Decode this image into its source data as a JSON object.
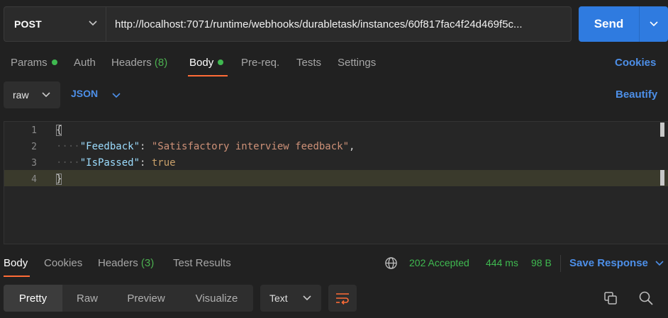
{
  "request": {
    "method": "POST",
    "url": "http://localhost:7071/runtime/webhooks/durabletask/instances/60f817fac4f24d469f5c...",
    "send_label": "Send"
  },
  "request_tabs": [
    {
      "label": "Params",
      "dot": true
    },
    {
      "label": "Auth"
    },
    {
      "label": "Headers",
      "count": "(8)"
    },
    {
      "label": "Body",
      "dot": true,
      "active": true
    },
    {
      "label": "Pre-req."
    },
    {
      "label": "Tests"
    },
    {
      "label": "Settings"
    }
  ],
  "cookies_label": "Cookies",
  "body_options": {
    "mode": "raw",
    "language": "JSON",
    "beautify_label": "Beautify"
  },
  "editor": {
    "line_numbers": [
      "1",
      "2",
      "3",
      "4"
    ],
    "open_brace": "{",
    "close_brace": "}",
    "key1": "\"Feedback\"",
    "val1": "\"Satisfactory interview feedback\"",
    "key2": "\"IsPassed\"",
    "val2": "true"
  },
  "response_tabs": [
    {
      "label": "Body",
      "active": true
    },
    {
      "label": "Cookies"
    },
    {
      "label": "Headers",
      "count": "(3)"
    },
    {
      "label": "Test Results"
    }
  ],
  "response_meta": {
    "status": "202 Accepted",
    "time": "444 ms",
    "size": "98 B",
    "save_label": "Save Response"
  },
  "format_options": [
    "Pretty",
    "Raw",
    "Preview",
    "Visualize"
  ],
  "text_mode": "Text",
  "colors": {
    "accent_orange": "#ff6c37",
    "link_blue": "#4d8fe8",
    "send_blue": "#2f7be0",
    "success_green": "#3fb950"
  }
}
